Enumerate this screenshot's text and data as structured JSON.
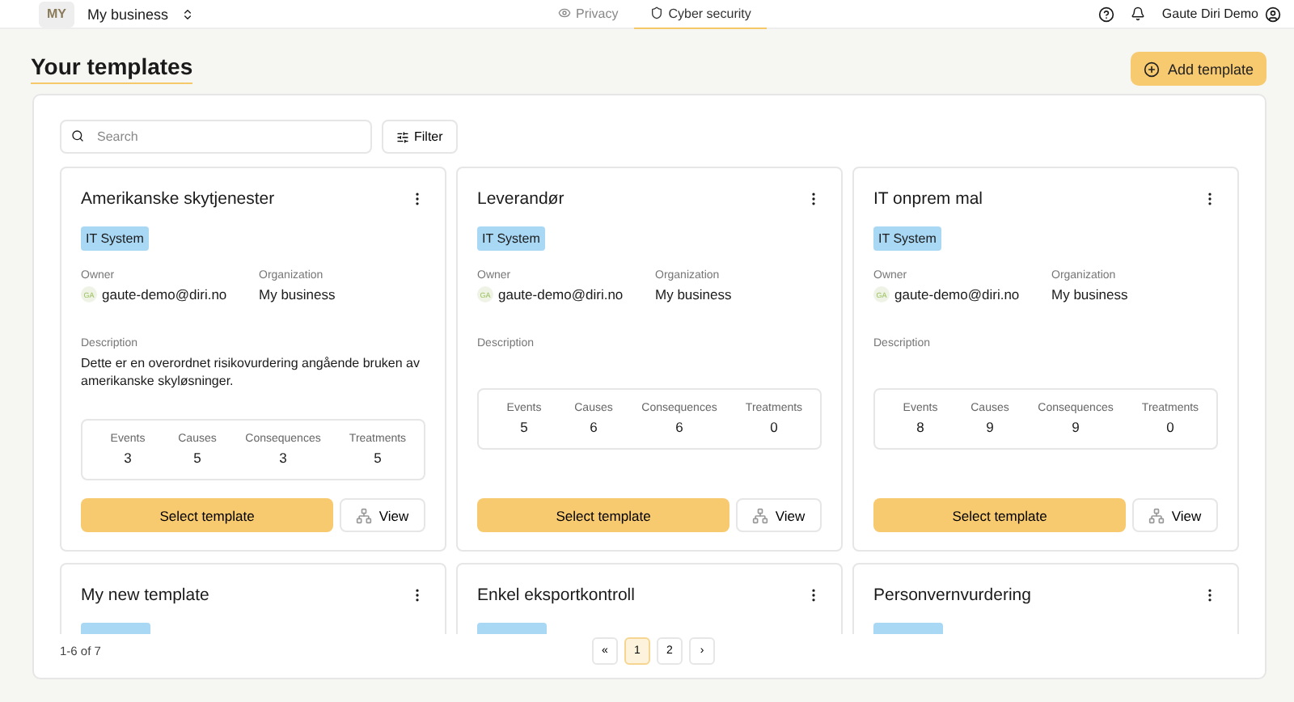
{
  "topbar": {
    "logo": "MY",
    "business": "My business",
    "tabs": [
      {
        "label": "Privacy",
        "selected": false
      },
      {
        "label": "Cyber security",
        "selected": true
      }
    ],
    "user": "Gaute Diri Demo"
  },
  "page": {
    "title": "Your templates",
    "add_button": "Add template"
  },
  "toolbar": {
    "search": {
      "placeholder": "Search"
    },
    "filter": "Filter"
  },
  "templates": [
    {
      "title": "Amerikanske skytjenester",
      "tag": "IT System",
      "owner_label": "Owner",
      "owner_initials": "GA",
      "owner": "gaute-demo@diri.no",
      "org_label": "Organization",
      "org": "My business",
      "description_label": "Description",
      "description": "Dette er en overordnet risikovurdering angående bruken av amerikanske skyløsninger.",
      "stats": [
        {
          "label": "Events",
          "value": "3"
        },
        {
          "label": "Causes",
          "value": "5"
        },
        {
          "label": "Consequences",
          "value": "3"
        },
        {
          "label": "Treatments",
          "value": "5"
        }
      ],
      "select": "Select template",
      "view": "View"
    },
    {
      "title": "Leverandør",
      "tag": "IT System",
      "owner_label": "Owner",
      "owner_initials": "GA",
      "owner": "gaute-demo@diri.no",
      "org_label": "Organization",
      "org": "My business",
      "description_label": "Description",
      "stats": [
        {
          "label": "Events",
          "value": "5"
        },
        {
          "label": "Causes",
          "value": "6"
        },
        {
          "label": "Consequences",
          "value": "6"
        },
        {
          "label": "Treatments",
          "value": "0"
        }
      ],
      "select": "Select template",
      "view": "View"
    },
    {
      "title": "IT onprem mal",
      "tag": "IT System",
      "owner_label": "Owner",
      "owner_initials": "GA",
      "owner": "gaute-demo@diri.no",
      "org_label": "Organization",
      "org": "My business",
      "description_label": "Description",
      "stats": [
        {
          "label": "Events",
          "value": "8"
        },
        {
          "label": "Causes",
          "value": "9"
        },
        {
          "label": "Consequences",
          "value": "9"
        },
        {
          "label": "Treatments",
          "value": "0"
        }
      ],
      "select": "Select template",
      "view": "View"
    },
    {
      "title": "My new template",
      "tag_cut_off": true
    },
    {
      "title": "Enkel eksportkontroll",
      "tag_cut_off": true
    },
    {
      "title": "Personvernvurdering",
      "tag_cut_off": true
    }
  ],
  "pagination": {
    "summary": "1-6 of 7",
    "first": "«",
    "next": "›",
    "pages": [
      {
        "label": "1",
        "selected": true
      },
      {
        "label": "2",
        "selected": false
      }
    ]
  }
}
